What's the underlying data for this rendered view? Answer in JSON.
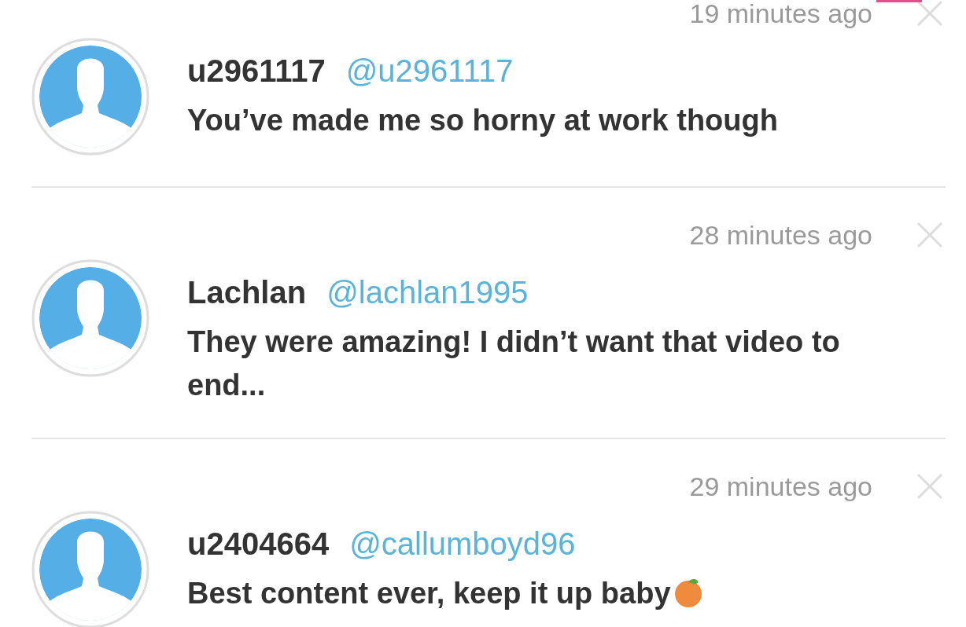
{
  "comments": [
    {
      "time": "19 minutes ago",
      "name": "u2961117",
      "handle": "@u2961117",
      "message": "You’ve made me so horny at work though"
    },
    {
      "time": "28 minutes ago",
      "name": "Lachlan",
      "handle": "@lachlan1995",
      "message": "They were amazing! I didn’t want that video to end..."
    },
    {
      "time": "29 minutes ago",
      "name": "u2404664",
      "handle": "@callumboyd96",
      "message": "Best content ever, keep it up baby",
      "emoji": true
    }
  ]
}
